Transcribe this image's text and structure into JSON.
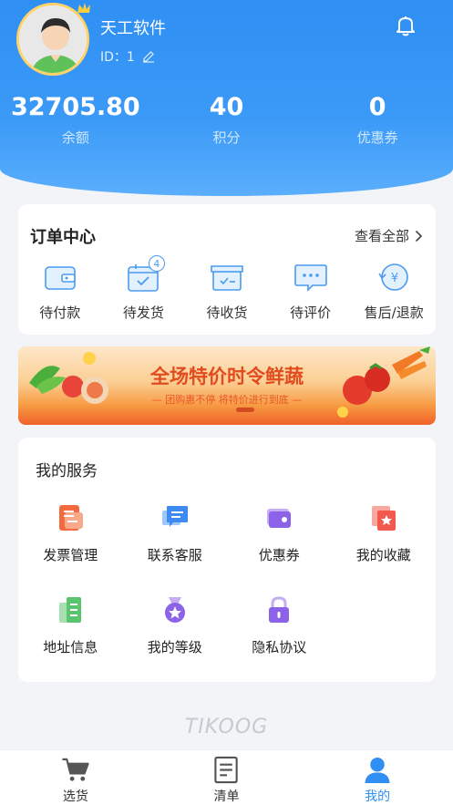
{
  "profile": {
    "name": "天工软件",
    "id_text": "ID：1"
  },
  "stats": [
    {
      "value": "32705.80",
      "label": "余额"
    },
    {
      "value": "40",
      "label": "积分"
    },
    {
      "value": "0",
      "label": "优惠券"
    }
  ],
  "orders": {
    "title": "订单中心",
    "see_all": "查看全部",
    "items": [
      {
        "label": "待付款",
        "icon": "wallet-icon"
      },
      {
        "label": "待发货",
        "icon": "calendar-check-icon",
        "badge": "4"
      },
      {
        "label": "待收货",
        "icon": "box-icon"
      },
      {
        "label": "待评价",
        "icon": "chat-icon"
      },
      {
        "label": "售后/退款",
        "icon": "refund-icon"
      }
    ]
  },
  "banner": {
    "title": "全场特价时令鲜蔬",
    "subtitle": "— 团购惠不停 将特价进行到底 —"
  },
  "services": {
    "title": "我的服务",
    "items": [
      {
        "label": "发票管理",
        "icon": "invoice-icon",
        "color": "#f26a3d"
      },
      {
        "label": "联系客服",
        "icon": "customer-service-icon",
        "color": "#3d8af2"
      },
      {
        "label": "优惠券",
        "icon": "coupon-icon",
        "color": "#8b62e8"
      },
      {
        "label": "我的收藏",
        "icon": "favorite-icon",
        "color": "#f25a4d"
      },
      {
        "label": "地址信息",
        "icon": "address-icon",
        "color": "#5bc46e"
      },
      {
        "label": "我的等级",
        "icon": "level-medal-icon",
        "color": "#8b62e8"
      },
      {
        "label": "隐私协议",
        "icon": "privacy-lock-icon",
        "color": "#8b62e8"
      }
    ]
  },
  "footer": {
    "logo": "TIKOOG"
  },
  "tabbar": {
    "items": [
      {
        "label": "选货",
        "icon": "cart-icon"
      },
      {
        "label": "清单",
        "icon": "list-icon"
      },
      {
        "label": "我的",
        "icon": "user-icon",
        "active": true
      }
    ]
  },
  "colors": {
    "accent": "#2f8ff3",
    "banner_text": "#e14b1e"
  }
}
